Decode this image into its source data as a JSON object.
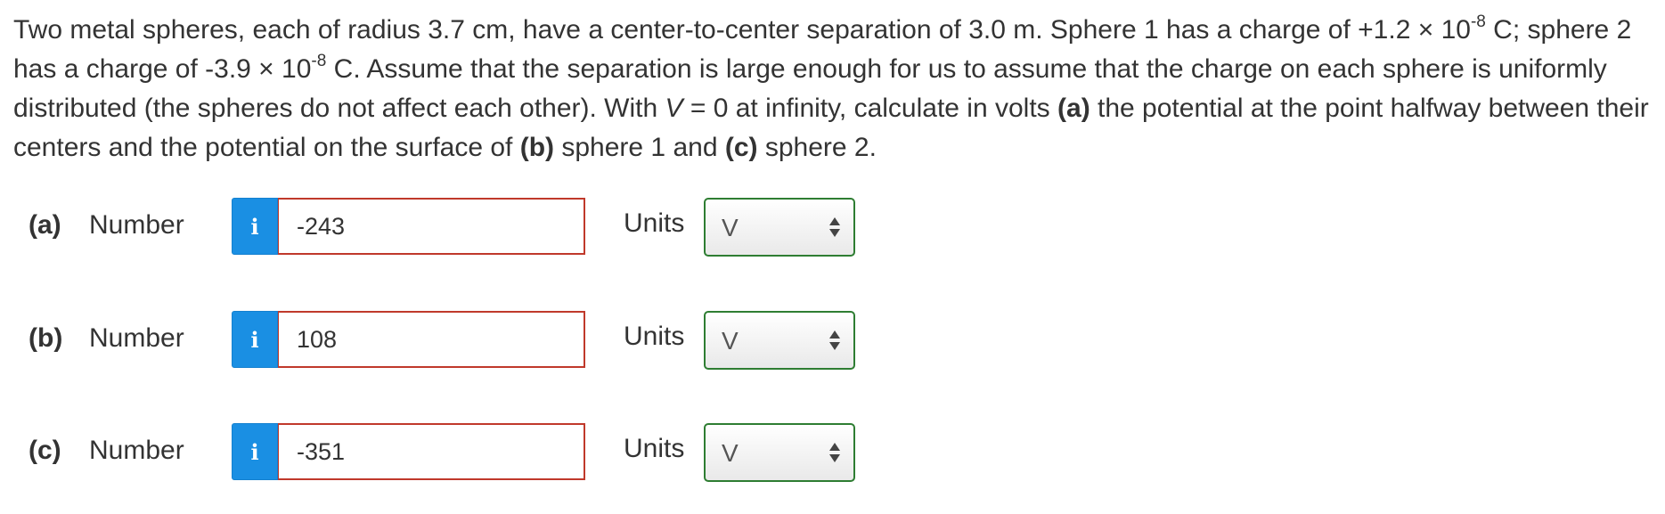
{
  "question": {
    "seg1": "Two metal spheres, each of radius 3.7 cm, have a center-to-center separation of 3.0 m. Sphere 1 has a charge of +1.2 × 10",
    "exp1": "-8",
    "seg2": " C; sphere 2 has a charge of -3.9 × 10",
    "exp2": "-8",
    "seg3": " C. Assume that the separation is large enough for us to assume that the charge on each sphere is uniformly distributed (the spheres do not affect each other). With ",
    "var_v": "V",
    "seg4": " = 0 at infinity, calculate in volts ",
    "bold_a": "(a)",
    "seg5": " the potential at the point halfway between their centers and the potential on the surface of ",
    "bold_b": "(b)",
    "seg6": " sphere 1 and ",
    "bold_c": "(c)",
    "seg7": " sphere 2."
  },
  "parts": [
    {
      "label": "(a)",
      "number_label": "Number",
      "info_icon": "i",
      "value": "-243",
      "units_label": "Units",
      "unit": "V"
    },
    {
      "label": "(b)",
      "number_label": "Number",
      "info_icon": "i",
      "value": "108",
      "units_label": "Units",
      "unit": "V"
    },
    {
      "label": "(c)",
      "number_label": "Number",
      "info_icon": "i",
      "value": "-351",
      "units_label": "Units",
      "unit": "V"
    }
  ],
  "colors": {
    "info_button": "#1a8fe3",
    "input_border": "#c0392b",
    "select_border": "#2e7d32",
    "text": "#333333"
  }
}
